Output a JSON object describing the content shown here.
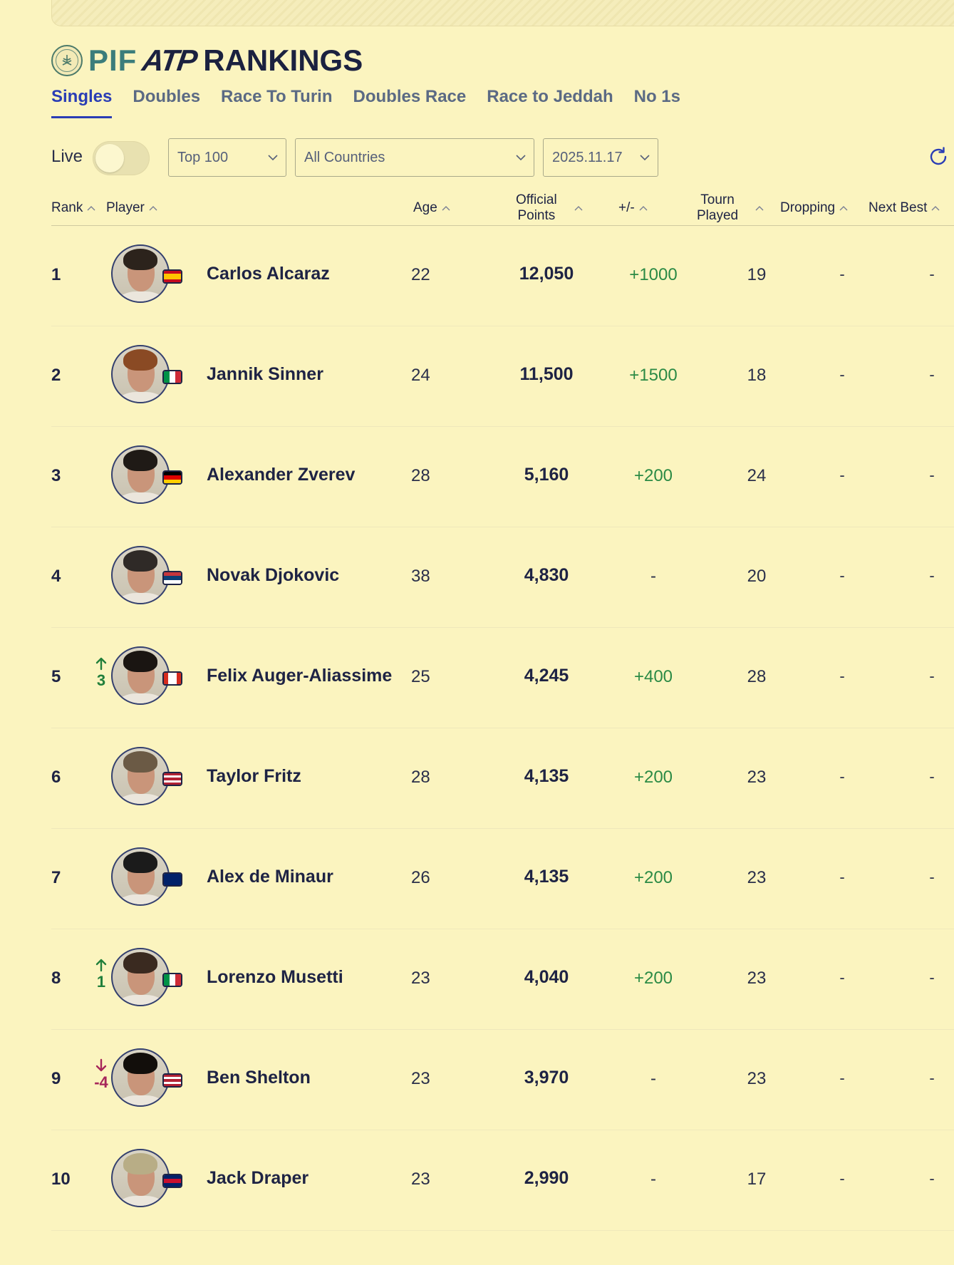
{
  "brand": {
    "pif": "PIF",
    "atp": "ATP",
    "title": "RANKINGS"
  },
  "tabs": [
    {
      "label": "Singles",
      "active": true
    },
    {
      "label": "Doubles"
    },
    {
      "label": "Race To Turin"
    },
    {
      "label": "Doubles Race"
    },
    {
      "label": "Race to Jeddah"
    },
    {
      "label": "No 1s"
    }
  ],
  "controls": {
    "live_label": "Live",
    "live_on": false,
    "range_select": "Top 100",
    "country_select": "All Countries",
    "date_select": "2025.11.17"
  },
  "columns": {
    "rank": "Rank",
    "player": "Player",
    "age": "Age",
    "points_line1": "Official",
    "points_line2": "Points",
    "plus_minus": "+/-",
    "tourn_line1": "Tourn",
    "tourn_line2": "Played",
    "dropping": "Dropping",
    "next_best": "Next Best"
  },
  "colors": {
    "accent": "#2a3db5",
    "positive": "#2b8a45",
    "negative": "#a6265a",
    "background": "#fbf4bf"
  },
  "rows": [
    {
      "rank": "1",
      "move": "",
      "name": "Carlos Alcaraz",
      "country": "ESP",
      "age": "22",
      "points": "12,050",
      "plus_minus": "+1000",
      "tourn": "19",
      "dropping": "-",
      "next_best": "-"
    },
    {
      "rank": "2",
      "move": "",
      "name": "Jannik Sinner",
      "country": "ITA",
      "age": "24",
      "points": "11,500",
      "plus_minus": "+1500",
      "tourn": "18",
      "dropping": "-",
      "next_best": "-"
    },
    {
      "rank": "3",
      "move": "",
      "name": "Alexander Zverev",
      "country": "GER",
      "age": "28",
      "points": "5,160",
      "plus_minus": "+200",
      "tourn": "24",
      "dropping": "-",
      "next_best": "-"
    },
    {
      "rank": "4",
      "move": "",
      "name": "Novak Djokovic",
      "country": "SRB",
      "age": "38",
      "points": "4,830",
      "plus_minus": "-",
      "tourn": "20",
      "dropping": "-",
      "next_best": "-"
    },
    {
      "rank": "5",
      "move": "3",
      "move_dir": "up",
      "name": "Felix Auger-Aliassime",
      "country": "CAN",
      "age": "25",
      "points": "4,245",
      "plus_minus": "+400",
      "tourn": "28",
      "dropping": "-",
      "next_best": "-"
    },
    {
      "rank": "6",
      "move": "",
      "name": "Taylor Fritz",
      "country": "USA",
      "age": "28",
      "points": "4,135",
      "plus_minus": "+200",
      "tourn": "23",
      "dropping": "-",
      "next_best": "-"
    },
    {
      "rank": "7",
      "move": "",
      "name": "Alex de Minaur",
      "country": "AUS",
      "age": "26",
      "points": "4,135",
      "plus_minus": "+200",
      "tourn": "23",
      "dropping": "-",
      "next_best": "-"
    },
    {
      "rank": "8",
      "move": "1",
      "move_dir": "up",
      "name": "Lorenzo Musetti",
      "country": "ITA",
      "age": "23",
      "points": "4,040",
      "plus_minus": "+200",
      "tourn": "23",
      "dropping": "-",
      "next_best": "-"
    },
    {
      "rank": "9",
      "move": "-4",
      "move_dir": "down",
      "name": "Ben Shelton",
      "country": "USA",
      "age": "23",
      "points": "3,970",
      "plus_minus": "-",
      "tourn": "23",
      "dropping": "-",
      "next_best": "-"
    },
    {
      "rank": "10",
      "move": "",
      "name": "Jack Draper",
      "country": "GBR",
      "age": "23",
      "points": "2,990",
      "plus_minus": "-",
      "tourn": "17",
      "dropping": "-",
      "next_best": "-"
    }
  ]
}
